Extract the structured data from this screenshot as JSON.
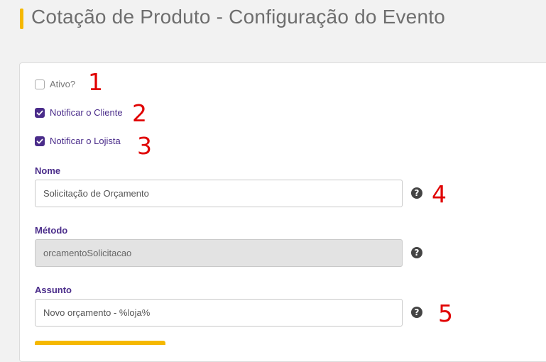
{
  "header": {
    "title": "Cotação de Produto - Configuração do Evento"
  },
  "form": {
    "ativo": {
      "label": "Ativo?",
      "checked": false
    },
    "notificar_cliente": {
      "label": "Notificar o Cliente",
      "checked": true
    },
    "notificar_lojista": {
      "label": "Notificar o Lojista",
      "checked": true
    },
    "nome": {
      "label": "Nome",
      "value": "Solicitação de Orçamento"
    },
    "metodo": {
      "label": "Método",
      "value": "orcamentoSolicitacao",
      "disabled": true
    },
    "assunto": {
      "label": "Assunto",
      "value": "Novo orçamento - %loja%"
    },
    "help_icon": "?"
  },
  "annotations": [
    "1",
    "2",
    "3",
    "4",
    "5"
  ],
  "colors": {
    "accent": "#f5b800",
    "primary": "#4a2c8a",
    "annotation": "#e00000"
  }
}
